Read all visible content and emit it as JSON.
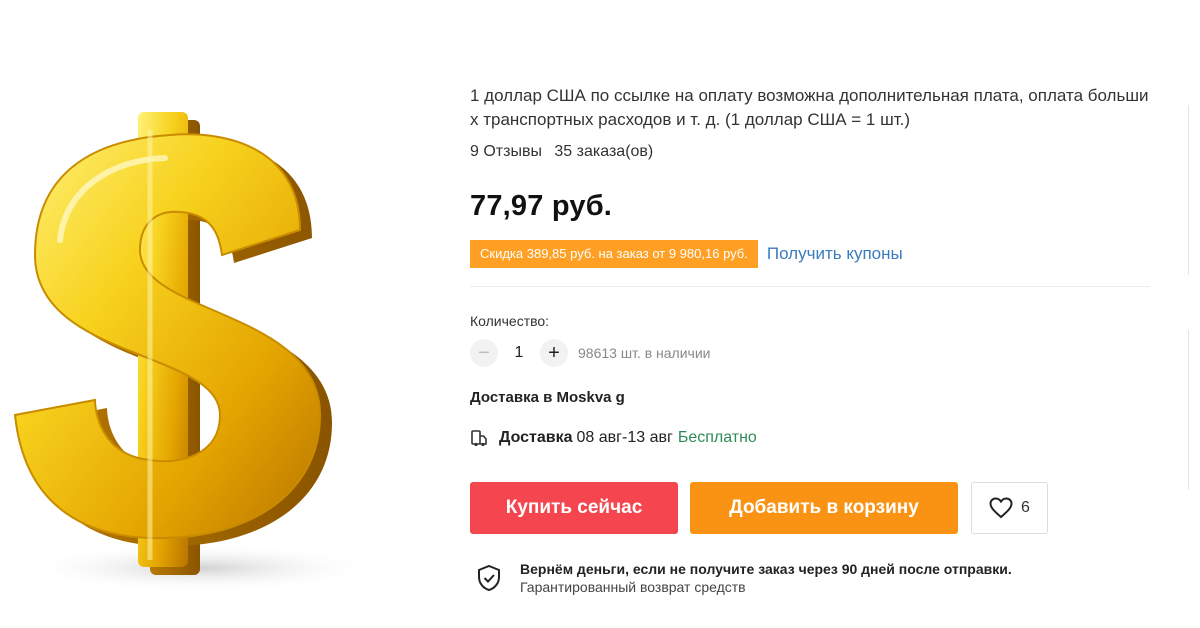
{
  "product": {
    "title": "1 доллар США по ссылке на оплату возможна дополнительная плата, оплата больших транспортных расходов и т. д. (1 доллар США = 1 шт.)",
    "reviews": "9 Отзывы",
    "orders": "35 заказа(ов)",
    "price": "77,97 руб."
  },
  "coupon": {
    "badge": "Скидка 389,85 руб. на заказ от 9 980,16 руб.",
    "link": "Получить купоны"
  },
  "quantity": {
    "label": "Количество:",
    "minus": "−",
    "value": "1",
    "plus": "+",
    "stock": "98613 шт. в наличии"
  },
  "delivery": {
    "destination": "Доставка в Moskva g",
    "label": "Доставка",
    "dates": "08 авг-13 авг",
    "cost": "Бесплатно"
  },
  "actions": {
    "buy_now": "Купить сейчас",
    "add_to_cart": "Добавить в корзину",
    "wishlist_count": "6"
  },
  "guarantee": {
    "title": "Вернём деньги, если не получите заказ через 90 дней после отправки.",
    "subtitle": "Гарантированный возврат средств"
  },
  "icons": {
    "product_image": "gold-dollar-sign",
    "delivery": "truck-icon",
    "wishlist": "heart-icon",
    "guarantee": "shield-check-icon"
  },
  "colors": {
    "buy": "#f5464f",
    "cart": "#fa9314",
    "coupon": "#ffa024",
    "link": "#3a7cbf",
    "free": "#2e8b57"
  }
}
